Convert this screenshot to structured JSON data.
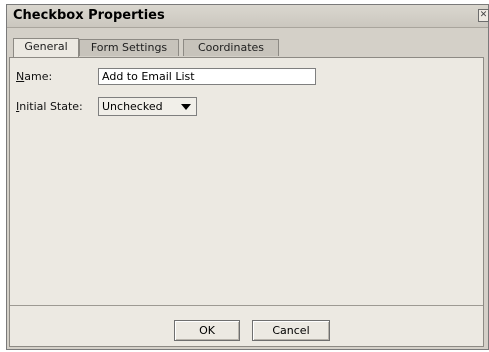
{
  "window": {
    "title": "Checkbox Properties",
    "close_icon": "close-icon"
  },
  "tabs": [
    {
      "label": "General",
      "active": true
    },
    {
      "label": "Form Settings",
      "active": false
    },
    {
      "label": "Coordinates",
      "active": false
    }
  ],
  "general": {
    "name_label": "Name:",
    "name_value": "Add to Email List",
    "initial_state_label": "Initial State:",
    "initial_state_value": "Unchecked"
  },
  "buttons": {
    "ok_label": "OK",
    "cancel_label": "Cancel"
  },
  "colors": {
    "dialog_bg": "#d4d0c8",
    "panel_bg": "#ece9e2"
  }
}
